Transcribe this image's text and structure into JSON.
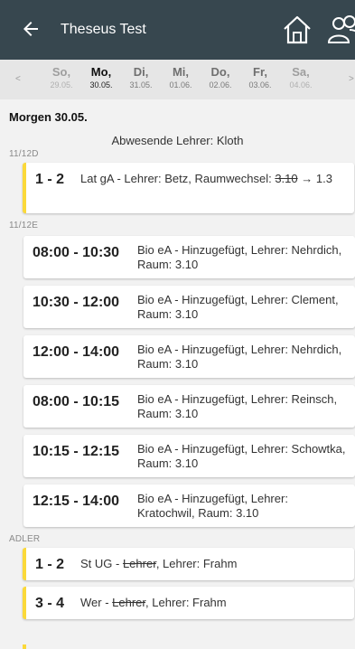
{
  "header": {
    "title": "Theseus Test",
    "colors": {
      "appbar": "#37474f",
      "accent": "#fbd93a"
    }
  },
  "days": {
    "prev": "<",
    "next": ">",
    "items": [
      {
        "weekday": "So,",
        "date": "29.05."
      },
      {
        "weekday": "Mo,",
        "date": "30.05.",
        "selected": true
      },
      {
        "weekday": "Di,",
        "date": "31.05."
      },
      {
        "weekday": "Mi,",
        "date": "01.06."
      },
      {
        "weekday": "Do,",
        "date": "02.06."
      },
      {
        "weekday": "Fr,",
        "date": "03.06."
      },
      {
        "weekday": "Sa,",
        "date": "04.06."
      }
    ]
  },
  "main": {
    "date_heading": "Morgen 30.05.",
    "absent": "Abwesende Lehrer: Kloth",
    "groups": [
      {
        "name": "11/12D",
        "entries": [
          {
            "time": "1 - 2",
            "prefix": "Lat gA - Lehrer: Betz, Raumwechsel: ",
            "struck": "3.10",
            "suffix": " → 1.3"
          }
        ]
      },
      {
        "name": "11/12E",
        "entries": [
          {
            "time": "08:00 - 10:30",
            "text": "Bio eA - Hinzugefügt, Lehrer: Nehrdich, Raum: 3.10"
          },
          {
            "time": "10:30 - 12:00",
            "text": "Bio eA - Hinzugefügt, Lehrer: Clement, Raum: 3.10"
          },
          {
            "time": "12:00 - 14:00",
            "text": "Bio eA - Hinzugefügt, Lehrer: Nehrdich, Raum: 3.10"
          },
          {
            "time": "08:00 - 10:15",
            "text": "Bio eA - Hinzugefügt, Lehrer: Reinsch, Raum: 3.10"
          },
          {
            "time": "10:15 - 12:15",
            "text": "Bio eA - Hinzugefügt, Lehrer: Schowtka, Raum: 3.10"
          },
          {
            "time": "12:15 - 14:00",
            "text": "Bio eA - Hinzugefügt, Lehrer: Kratochwil, Raum: 3.10"
          }
        ]
      },
      {
        "name": "ADLER",
        "entries": [
          {
            "time": "1 - 2",
            "prefix": "St UG - ",
            "struck": "Lehrer",
            "suffix": ", Lehrer: Frahm"
          },
          {
            "time": "3 - 4",
            "prefix": "Wer - ",
            "struck": "Lehrer",
            "suffix": ", Lehrer: Frahm"
          }
        ]
      }
    ]
  }
}
